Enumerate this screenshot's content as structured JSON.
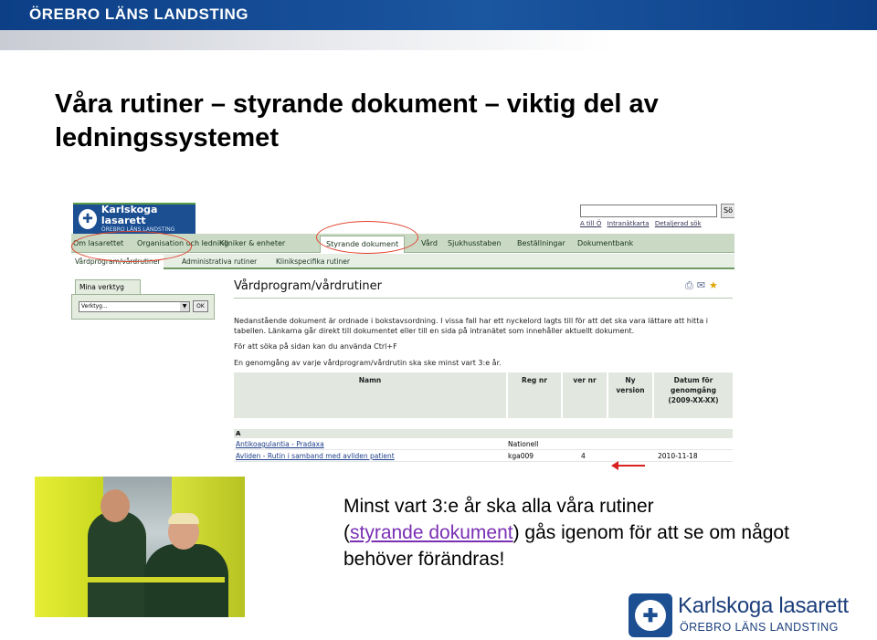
{
  "banner": {
    "brand": "ÖREBRO LÄNS LANDSTING"
  },
  "slide": {
    "title": "Våra rutiner – styrande dokument – viktig del av ledningssystemet",
    "body_line1": "Minst vart 3:e år ska alla våra rutiner",
    "body_open_paren": "(",
    "body_link": "styrande dokument",
    "body_rest": ") gås igenom för att se om något",
    "body_line3": "behöver förändras!"
  },
  "intranet": {
    "logo_title": "Karlskoga lasarett",
    "logo_sub": "ÖREBRO LÄNS LANDSTING",
    "search_button": "Sö",
    "top_links": [
      "A till Ö",
      "Intranätkarta",
      "Detaljerad sök"
    ],
    "nav": [
      "Om lasarettet",
      "Organisation och ledning",
      "Kliniker & enheter",
      "Styrande dokument",
      "Vård",
      "Sjukhusstaben",
      "Beställningar",
      "Dokumentbank"
    ],
    "subnav": [
      "Vårdprogram/vårdrutiner",
      "Administrativa rutiner",
      "Klinikspecifika rutiner"
    ],
    "tools_tab": "Mina verktyg",
    "tools_select": "Verktyg...",
    "tools_ok": "OK",
    "heading": "Vårdprogram/vårdrutiner",
    "intro": "Nedanstående dokument är ordnade i bokstavsordning. I vissa fall har ett nyckelord lagts till för att det ska vara lättare att hitta i tabellen. Länkarna går direkt till dokumentet eller till en sida på intranätet som innehåller aktuellt dokument.",
    "search_hint": "För att söka på sidan kan du använda Ctrl+F",
    "review_note": "En genomgång av varje vårdprogram/vårdrutin ska ske minst vart 3:e år.",
    "columns": [
      "Namn",
      "Reg nr",
      "ver nr",
      "Ny version",
      "Datum för genomgång (2009-XX-XX)"
    ],
    "letter": "A",
    "rows": [
      {
        "name": "Antikoagulantia - Pradaxa",
        "reg": "Nationell",
        "ver": "",
        "new": "",
        "date": ""
      },
      {
        "name": "Avliden - Rutin i samband med avliden patient",
        "reg": "kga009",
        "ver": "4",
        "new": "",
        "date": "2010-11-18"
      }
    ]
  },
  "footer_logo": {
    "name": "Karlskoga lasarett",
    "sub": "ÖREBRO LÄNS LANDSTING"
  },
  "colors": {
    "brand_blue": "#1c4f92",
    "nav_green": "#cad9c4",
    "highlight_red": "#e0412a",
    "link_purple": "#7a2fb4"
  }
}
